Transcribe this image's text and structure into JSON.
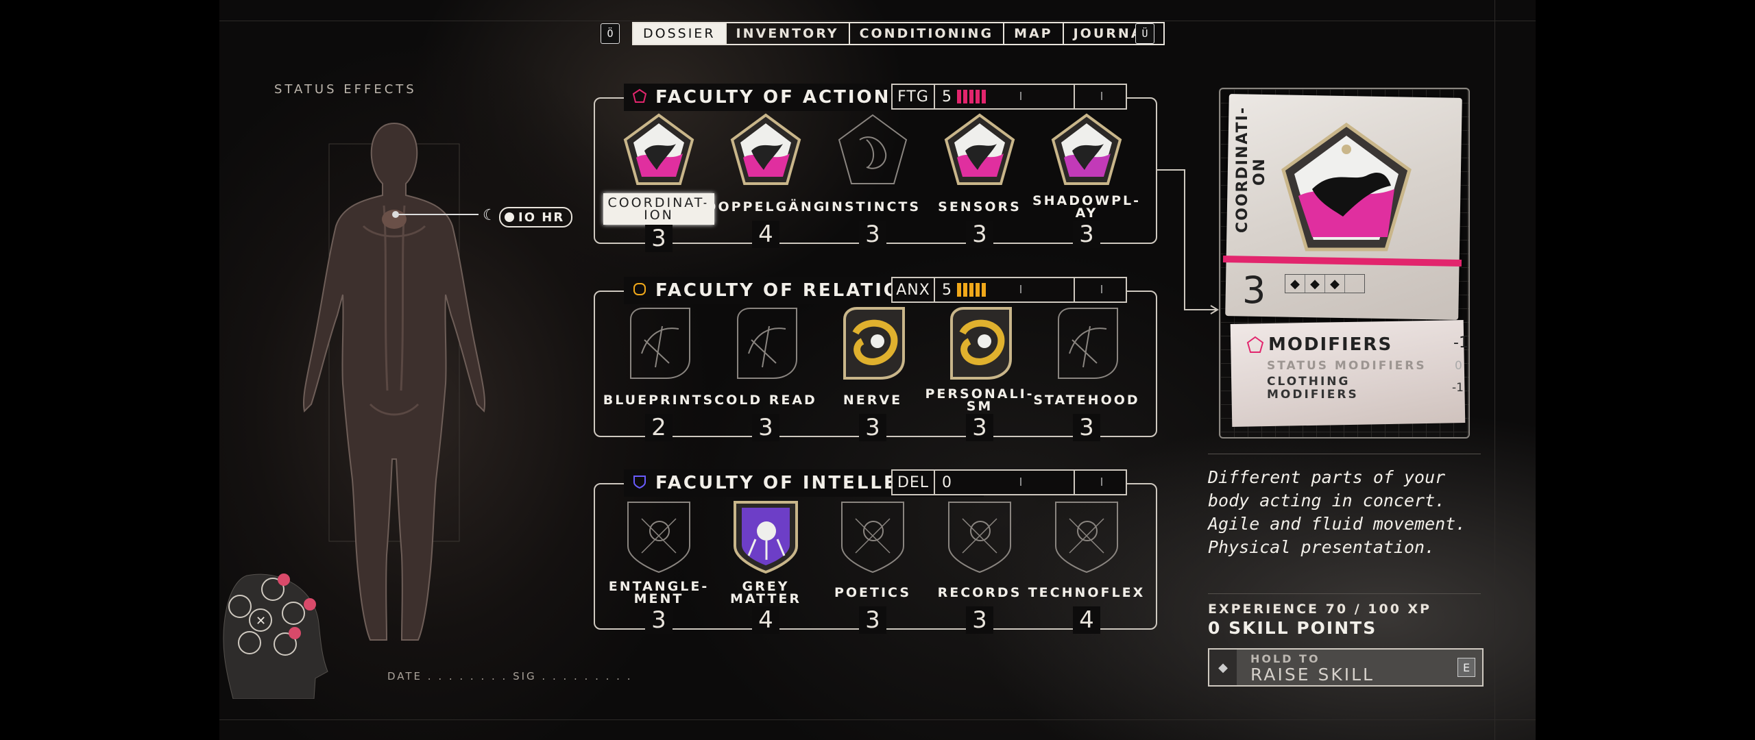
{
  "nav": {
    "left_key": "Ö",
    "right_key": "Ü",
    "tabs": [
      {
        "label": "DOSSIER",
        "active": true
      },
      {
        "label": "INVENTORY",
        "active": false
      },
      {
        "label": "CONDITIONING",
        "active": false
      },
      {
        "label": "MAP",
        "active": false
      },
      {
        "label": "JOURNAL",
        "active": false
      }
    ]
  },
  "left": {
    "status_title": "STATUS EFFECTS",
    "status_hr": "IO HR",
    "date_sig": "DATE . . . . . . . . SIG . . . . . . . . ."
  },
  "faculties": [
    {
      "title": "FACULTY OF ACTION",
      "icon": "pentagon-icon",
      "color": "#e2256d",
      "meter_code": "FTG",
      "meter_value": "5",
      "meter_bar_color": "#e2256d",
      "skills": [
        {
          "name": "COORDINAT-\nION",
          "value": "3",
          "selected": true,
          "color": "#e02f9f"
        },
        {
          "name": "DOPPELGÄNG",
          "value": "4",
          "selected": false,
          "color": "#e02f9f"
        },
        {
          "name": "INSTINCTS",
          "value": "3",
          "selected": false,
          "color": "none"
        },
        {
          "name": "SENSORS",
          "value": "3",
          "selected": false,
          "color": "#e02f9f"
        },
        {
          "name": "SHADOWPL-\nAY",
          "value": "3",
          "selected": false,
          "color": "#c23ab8"
        }
      ]
    },
    {
      "title": "FACULTY OF RELATION",
      "icon": "rounded-square-icon",
      "color": "#f0a81a",
      "meter_code": "ANX",
      "meter_value": "5",
      "meter_bar_color": "#f0a81a",
      "skills": [
        {
          "name": "BLUEPRINTS",
          "value": "2",
          "selected": false,
          "color": "none"
        },
        {
          "name": "COLD READ",
          "value": "3",
          "selected": false,
          "color": "none"
        },
        {
          "name": "NERVE",
          "value": "3",
          "selected": false,
          "color": "#e0b12e"
        },
        {
          "name": "PERSONALI-\nSM",
          "value": "3",
          "selected": false,
          "color": "#e0b12e"
        },
        {
          "name": "STATEHOOD",
          "value": "3",
          "selected": false,
          "color": "none"
        }
      ]
    },
    {
      "title": "FACULTY OF INTELLECT",
      "icon": "shield-icon",
      "color": "#6a5cff",
      "meter_code": "DEL",
      "meter_value": "0",
      "meter_bar_color": "#6a5cff",
      "skills": [
        {
          "name": "ENTANGLE-\nMENT",
          "value": "3",
          "selected": false,
          "color": "none"
        },
        {
          "name": "GREY\nMATTER",
          "value": "4",
          "selected": false,
          "color": "#6d3ec7"
        },
        {
          "name": "POETICS",
          "value": "3",
          "selected": false,
          "color": "none"
        },
        {
          "name": "RECORDS",
          "value": "3",
          "selected": false,
          "color": "none"
        },
        {
          "name": "TECHNOFLEX",
          "value": "4",
          "selected": false,
          "color": "none"
        }
      ]
    }
  ],
  "card": {
    "name": "COORDINATI-\nON",
    "level": "3",
    "modifiers_title": "MODIFIERS",
    "status_modifiers": "STATUS MODIFIERS",
    "status_modifiers_value": "0",
    "clothing_modifiers": "CLOTHING\nMODIFIERS",
    "clothing_modifiers_value": "-1",
    "modifiers_total": "-1",
    "accent": "#e2256d"
  },
  "right": {
    "description": "Different parts of your body acting in concert. Agile and fluid movement. Physical presentation.",
    "experience": "EXPERIENCE 70 / 100 XP",
    "skill_points": "0 SKILL POINTS",
    "hold_to": "HOLD TO",
    "raise_skill": "RAISE SKILL",
    "raise_key": "E"
  }
}
